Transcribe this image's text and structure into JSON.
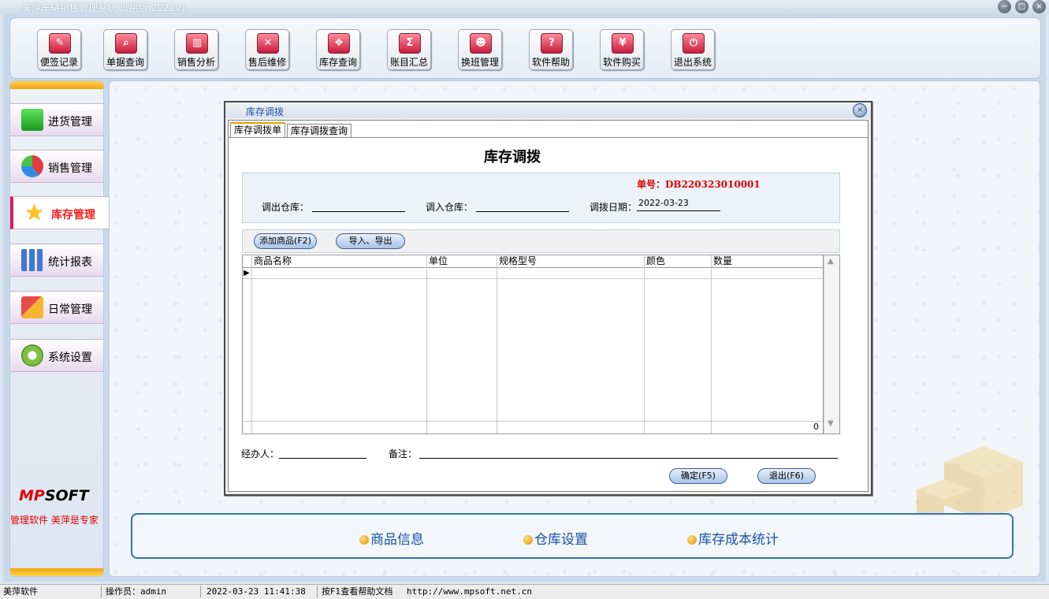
{
  "window": {
    "title": "美萍车辆销售管理系统 试用版 2022v1",
    "buttons": [
      "−",
      "□",
      "×"
    ]
  },
  "toolbar": {
    "items": [
      {
        "label": "便签记录",
        "icon": "notepad-icon",
        "glyph": "✎"
      },
      {
        "label": "单据查询",
        "icon": "magnifier-icon",
        "glyph": "⌕"
      },
      {
        "label": "销售分析",
        "icon": "bar-chart-icon",
        "glyph": "▥"
      },
      {
        "label": "售后维修",
        "icon": "screwdriver-icon",
        "glyph": "✕"
      },
      {
        "label": "库存查询",
        "icon": "boxes-icon",
        "glyph": "❖"
      },
      {
        "label": "账目汇总",
        "icon": "sigma-icon",
        "glyph": "Σ"
      },
      {
        "label": "换班管理",
        "icon": "users-icon",
        "glyph": "☻"
      },
      {
        "label": "软件帮助",
        "icon": "help-icon",
        "glyph": "?"
      },
      {
        "label": "软件购买",
        "icon": "yen-icon",
        "glyph": "¥"
      },
      {
        "label": "退出系统",
        "icon": "power-icon",
        "glyph": "⏻"
      }
    ]
  },
  "sidebar": {
    "items": [
      {
        "label": "进货管理",
        "icon": "green-plus-icon",
        "active": false
      },
      {
        "label": "销售管理",
        "icon": "pie-chart-icon",
        "active": false
      },
      {
        "label": "库存管理",
        "icon": "star-icon",
        "active": true
      },
      {
        "label": "统计报表",
        "icon": "bar-chart-icon",
        "active": false
      },
      {
        "label": "日常管理",
        "icon": "tools-icon",
        "active": false
      },
      {
        "label": "系统设置",
        "icon": "gear-icon",
        "active": false
      }
    ],
    "logo": {
      "mp": "MP",
      "soft": "SOFT"
    },
    "slogan": "管理软件 美萍是专家"
  },
  "dialog": {
    "title": "库存调拨",
    "close": "×",
    "tabs": [
      {
        "label": "库存调拨单",
        "active": true
      },
      {
        "label": "库存调拨查询",
        "active": false
      }
    ],
    "form_title": "库存调拨",
    "order_no_label": "单号：",
    "order_no": "DB220323010001",
    "fields": {
      "out_wh_label": "调出仓库：",
      "out_wh_value": "",
      "in_wh_label": "调入仓库：",
      "in_wh_value": "",
      "date_label": "调拨日期：",
      "date_value": "2022-03-23"
    },
    "buttons": {
      "add": "添加商品(F2)",
      "import_export": "导入、导出",
      "ok": "确定(F5)",
      "exit": "退出(F6)"
    },
    "grid": {
      "columns": [
        "商品名称",
        "单位",
        "规格型号",
        "颜色",
        "数量"
      ],
      "row_pointer": "▶",
      "total_qty": "0",
      "scroll_up": "▲",
      "scroll_down": "▼"
    },
    "handler_label": "经办人：",
    "handler_value": "",
    "remark_label": "备注：",
    "remark_value": ""
  },
  "quick_links": [
    "商品信息",
    "仓库设置",
    "库存成本统计"
  ],
  "statusbar": {
    "company": "美萍软件",
    "operator": "操作员：admin",
    "datetime": "2022-03-23 11:41:38",
    "help": "按F1查看帮助文档",
    "url": "http://www.mpsoft.net.cn"
  },
  "colors": {
    "accent_red": "#e00000",
    "link_blue": "#1651a7",
    "active_nav_border": "#d81b60",
    "sidebar_cap": "#f1a410"
  }
}
